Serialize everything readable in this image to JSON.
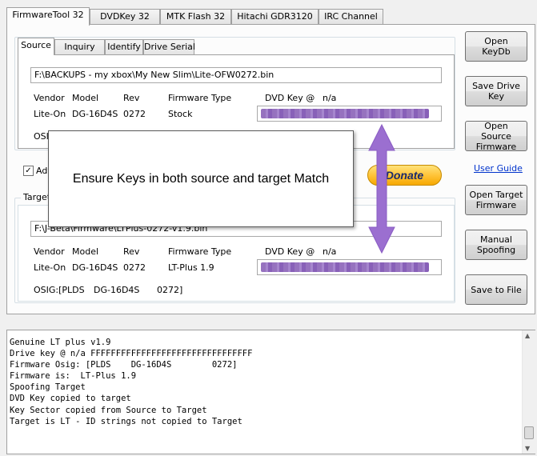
{
  "top_tabs": [
    "FirmwareTool 32",
    "DVDKey 32",
    "MTK Flash 32",
    "Hitachi GDR3120",
    "IRC Channel"
  ],
  "source": {
    "tabs": [
      "Source",
      "Inquiry",
      "Identify",
      "Drive Serial"
    ],
    "path": "F:\\BACKUPS - my xbox\\My New Slim\\Lite-OFW0272.bin",
    "headers": {
      "vendor": "Vendor",
      "model": "Model",
      "rev": "Rev",
      "fwtype": "Firmware Type",
      "dvdkey": "DVD Key @",
      "keyloc": "n/a"
    },
    "values": {
      "vendor": "Lite-On",
      "model": "DG-16D4S",
      "rev": "0272",
      "fwtype": "Stock"
    },
    "osig_prefix": "OSIG"
  },
  "advanced_label": "Adv",
  "target": {
    "group_label": "Target",
    "path": "F:\\J-Beta\\Firmware\\LTPlus-0272-v1.9.bin",
    "headers": {
      "vendor": "Vendor",
      "model": "Model",
      "rev": "Rev",
      "fwtype": "Firmware Type",
      "dvdkey": "DVD Key @",
      "keyloc": "n/a"
    },
    "values": {
      "vendor": "Lite-On",
      "model": "DG-16D4S",
      "rev": "0272",
      "fwtype": "LT-Plus 1.9"
    },
    "osig": {
      "a": "OSIG:[PLDS",
      "b": "DG-16D4S",
      "c": "0272]"
    }
  },
  "buttons": {
    "open_keydb": "Open  KeyDb",
    "save_drive_key": "Save Drive Key",
    "open_source_fw": "Open Source Firmware",
    "user_guide": "User Guide",
    "open_target_fw": "Open Target Firmware",
    "manual_spoofing": "Manual Spoofing",
    "save_to_file": "Save to File",
    "donate": "Donate"
  },
  "callout_text": "Ensure Keys in both source and target Match",
  "log_lines": [
    "Genuine LT plus v1.9",
    "Drive key @ n/a FFFFFFFFFFFFFFFFFFFFFFFFFFFFFFFF",
    "Firmware Osig: [PLDS    DG-16D4S        0272]",
    "Firmware is:  LT-Plus 1.9",
    "Spoofing Target",
    "DVD Key copied to target",
    "Key Sector copied from Source to Target",
    "Target is LT - ID strings not copied to Target"
  ],
  "colors": {
    "arrow": "#9b6fd0",
    "link": "#0033cc",
    "donate": "#ffc43a"
  }
}
